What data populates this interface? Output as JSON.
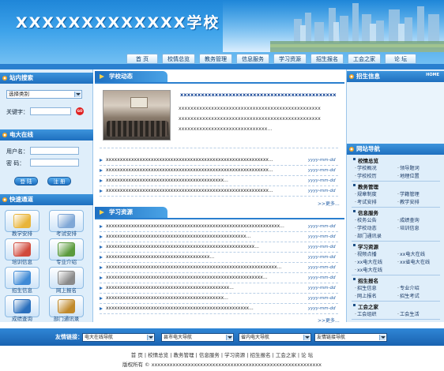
{
  "header": {
    "title": "XXXXXXXXXXXXX学校",
    "nav": [
      "首 页",
      "校情总览",
      "教务管理",
      "信息服务",
      "学习资源",
      "招生报名",
      "工会之家",
      "论 坛"
    ]
  },
  "search": {
    "heading": "站内搜索",
    "category_selected": "选择类别",
    "keyword_label": "关键字：",
    "go_label": "GO"
  },
  "login": {
    "heading": "电大在线",
    "username_label": "用户名：",
    "password_label": "密  码：",
    "login_button": "登 陆",
    "register_button": "注 册"
  },
  "quick": {
    "heading": "快速通道",
    "items": [
      {
        "label": "教学安排",
        "color": "#e8b43a"
      },
      {
        "label": "考试安排",
        "color": "#7fa7d6"
      },
      {
        "label": "培训信息",
        "color": "#d14a3c"
      },
      {
        "label": "专业介绍",
        "color": "#5a9a3c"
      },
      {
        "label": "招生信息",
        "color": "#3e8ad6"
      },
      {
        "label": "网上报名",
        "color": "#8a8a8a"
      },
      {
        "label": "成绩查询",
        "color": "#2a6fbd"
      },
      {
        "label": "部门通讯录",
        "color": "#c0892a"
      }
    ]
  },
  "school_news": {
    "heading": "学校动态",
    "headline": "xxxxxxxxxxxxxxxxxxxxxxxxxxxxxxxxxxxxxxxxxxxxx",
    "summary": [
      "xxxxxxxxxxxxxxxxxxxxxxxxxxxxxxxxxxxxxxxxxxxxxxxx",
      "xxxxxxxxxxxxxxxxxxxxxxxxxxxxxxxxxxxxxxxxxxxxxxxx",
      "xxxxxxxxxxxxxxxxxxxxxxxxxxxxxx..."
    ],
    "items": [
      {
        "title": "xxxxxxxxxxxxxxxxxxxxxxxxxxxxxxxxxxxxxxxxxxxxxxxxxxxxxxxxxx...",
        "date": "yyyy-mm-dd"
      },
      {
        "title": "xxxxxxxxxxxxxxxxxxxxxxxxxxxxxxxxxxxxxxxxxxxxxxxxxxxxxxxxxx...",
        "date": "yyyy-mm-dd"
      },
      {
        "title": "xxxxxxxxxxxxxxxxxxxxxxxxxxxxxxxxxxxxxxxxxx...",
        "date": "yyyy-mm-dd"
      },
      {
        "title": "xxxxxxxxxxxxxxxxxxxxxxxxxxxxxxxxxxxxxxxxxxxxxxxxxxxxxxxxxx...",
        "date": "yyyy-mm-dd"
      }
    ],
    "more": ">>更多..."
  },
  "learning": {
    "heading": "学习资源",
    "items": [
      {
        "title": "xxxxxxxxxxxxxxxxxxxxxxxxxxxxxxxxxxxxxxxxxxxxxxxxxxxxxxxxxxxxxx...",
        "date": "yyyy-mm-dd"
      },
      {
        "title": "xxxxxxxxxxxxxxxxxxxxxxxxxxxxxxxxxxxxxxxxxxxxxxxxxx...",
        "date": "yyyy-mm-dd"
      },
      {
        "title": "xxxxxxxxxxxxxxxxxxxxxxxxxxxxxxxxxxxxxxxxxxxxxxxxxxxxx...",
        "date": "yyyy-mm-dd"
      },
      {
        "title": "xxxxxxxxxxxxxxxxxxxxxxxxxxxxxxxxxxxxx...",
        "date": "yyyy-mm-dd"
      },
      {
        "title": "xxxxxxxxxxxxxxxxxxxxxxxxxxxxxxxxxxxxxxxxxxxxxxxxxxxxxxxxxxxxx...",
        "date": "yyyy-mm-dd"
      },
      {
        "title": "xxxxxxxxxxxxxxxxxxxxxxxxxxxxxxxxxxxxxxxxxxxxxxxxxxxxxxxx...",
        "date": "yyyy-mm-dd"
      },
      {
        "title": "xxxxxxxxxxxxxxxxxxxxxxxxxxxxxxxxxxxxxxxxxxxx...",
        "date": "yyyy-mm-dd"
      },
      {
        "title": "xxxxxxxxxxxxxxxxxxxxxxxxxxxxxxxxxxxxxxxxxx...",
        "date": "yyyy-mm-dd"
      },
      {
        "title": "xxxxxxxxxxxxxxxxxxxxxxxxxxxxxxxxxxxxxxxxxxxxxxxxxxx...",
        "date": "yyyy-mm-dd"
      }
    ],
    "more": ">>更多..."
  },
  "recruit": {
    "heading": "招生信息",
    "home": "HOME"
  },
  "site_nav": {
    "heading": "网站导航",
    "groups": [
      {
        "title": "校情总览",
        "links": [
          "学校概况",
          "领导题词",
          "学校校历",
          "地理位置"
        ]
      },
      {
        "title": "教务管理",
        "links": [
          "规章制度",
          "学籍管理",
          "考试安排",
          "教学安排"
        ]
      },
      {
        "title": "信息服务",
        "links": [
          "校务公告",
          "成绩查询",
          "学校动态",
          "培训信息",
          "部门通讯录"
        ]
      },
      {
        "title": "学习资源",
        "links": [
          "视频点播",
          "xx电大在线",
          "xx电大在线",
          "xx省电大在线",
          "xx电大在线"
        ]
      },
      {
        "title": "招生报名",
        "links": [
          "招生信息",
          "专业介绍",
          "网上报名",
          "招生考试"
        ]
      },
      {
        "title": "工会之家",
        "links": [
          "工会组织",
          "工会生活"
        ]
      }
    ]
  },
  "footer": {
    "friend_label": "友情链接：",
    "friend_selects": [
      "电大在线导航",
      "县市电大导航",
      "省内电大导航",
      "友情链接导航"
    ],
    "links": [
      "首 页",
      "校情总览",
      "教务管理",
      "信息服务",
      "学习资源",
      "招生报名",
      "工会之家",
      "论 坛"
    ],
    "copyright": "版权所有 © xxxxxxxxxxxxxxxxxxxxxxxxxxxxxxxxxxxxxxxxxxxxxxxxxxxxxxxx"
  }
}
